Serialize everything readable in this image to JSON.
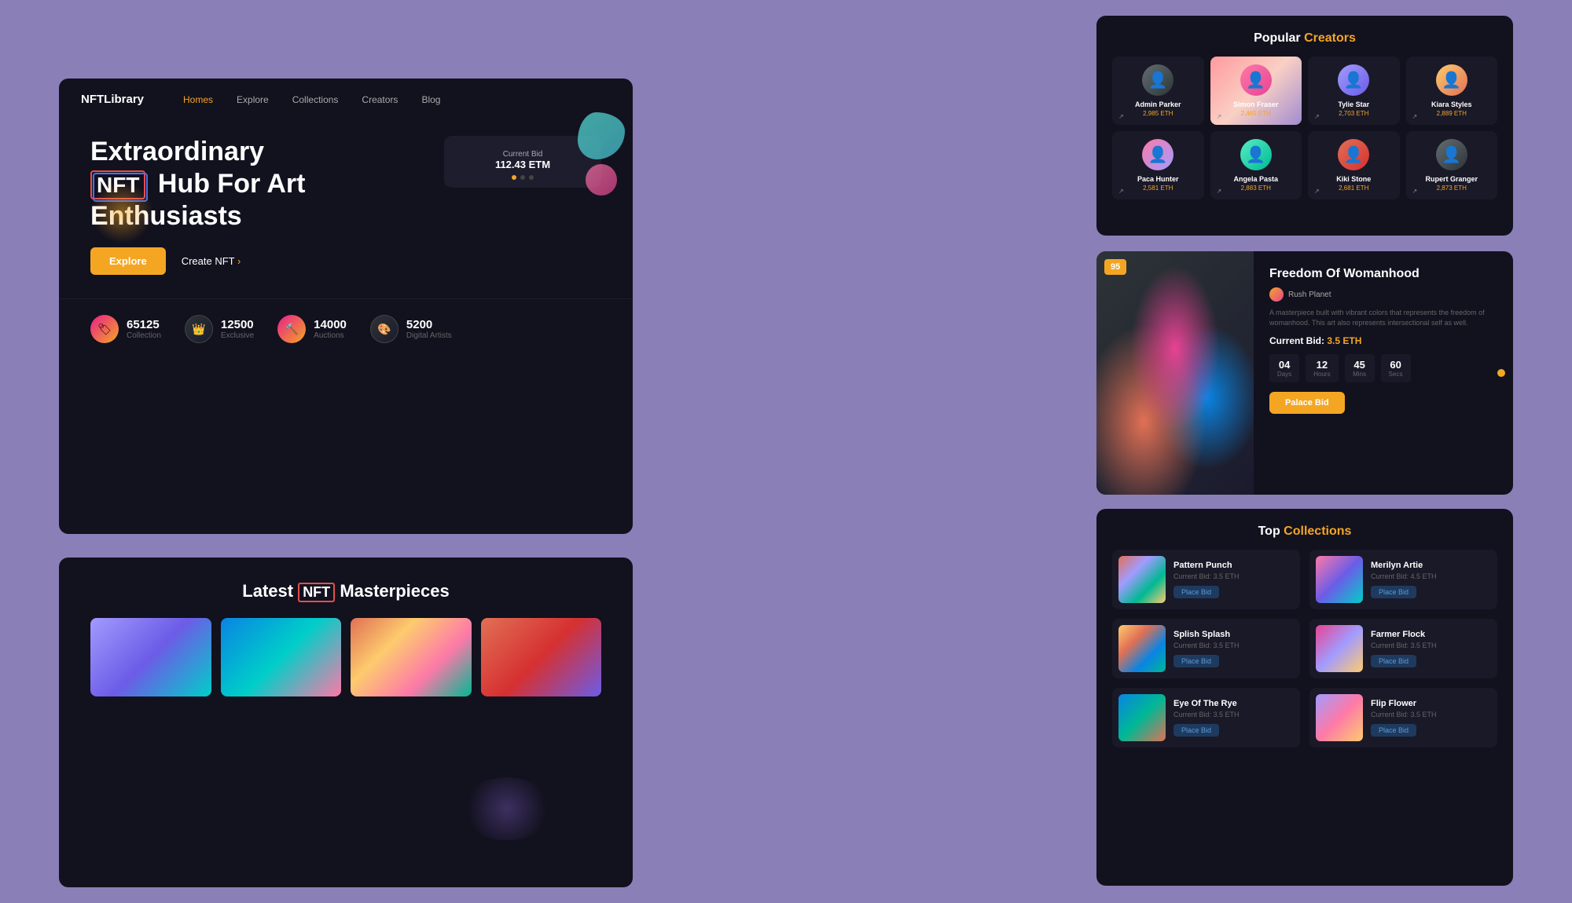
{
  "brand": "NFTLibrary",
  "nav": {
    "links": [
      "Homes",
      "Explore",
      "Collections",
      "Creators",
      "Blog"
    ],
    "active": "Homes"
  },
  "hero": {
    "line1": "Extraordinary",
    "nft_badge": "NFT",
    "line2": "Hub For Art",
    "line3": "Enthusiasts",
    "btn_explore": "Explore",
    "btn_create": "Create NFT",
    "current_bid_label": "Current Bid",
    "current_bid_value": "112.43 ETM",
    "dots": [
      true,
      false,
      false
    ]
  },
  "stats": [
    {
      "value": "65125",
      "label": "Collection"
    },
    {
      "value": "12500",
      "label": "Exclusive"
    },
    {
      "value": "14000",
      "label": "Auctions"
    },
    {
      "value": "5200",
      "label": "Digital Artists"
    }
  ],
  "popular_creators": {
    "title_plain": "Popular",
    "title_highlight": "Creators",
    "creators": [
      {
        "name": "Admin Parker",
        "eth": "2,985 ETH"
      },
      {
        "name": "Simon Fraser",
        "eth": "2,465 ETH",
        "featured": true
      },
      {
        "name": "Tylie Star",
        "eth": "2,703 ETH"
      },
      {
        "name": "Kiara Styles",
        "eth": "2,889 ETH"
      },
      {
        "name": "Paca Hunter",
        "eth": "2,581 ETH"
      },
      {
        "name": "Angela Pasta",
        "eth": "2,883 ETH"
      },
      {
        "name": "Kiki Stone",
        "eth": "2,681 ETH"
      },
      {
        "name": "Rupert Granger",
        "eth": "2,873 ETH"
      }
    ]
  },
  "featured_art": {
    "score": "95",
    "title": "Freedom Of Womanhood",
    "creator": "Rush Planet",
    "description": "A masterpiece built with vibrant colors that represents the freedom of womanhood. This art also represents intersectional self as well.",
    "bid_label": "Current Bid:",
    "bid_value": "3.5 ETH",
    "timer": [
      {
        "val": "04",
        "label": "Days"
      },
      {
        "val": "12",
        "label": "Hours"
      },
      {
        "val": "45",
        "label": "Mins"
      },
      {
        "val": "60",
        "label": "Secs"
      }
    ],
    "btn_palace": "Palace Bid"
  },
  "latest_masterpieces": {
    "title_plain": "Latest",
    "nft_badge": "NFT",
    "title_end": "Masterpieces"
  },
  "top_collections": {
    "title_plain": "Top",
    "title_highlight": "Collections",
    "items": [
      {
        "name": "Pattern Punch",
        "bid": "Current Bid: 3.5 ETH",
        "btn": "Place Bid"
      },
      {
        "name": "Merilyn Artie",
        "bid": "Current Bid: 4.5 ETH",
        "btn": "Place Bid"
      },
      {
        "name": "Splish Splash",
        "bid": "Current Bid: 3.5 ETH",
        "btn": "Place Bid"
      },
      {
        "name": "Farmer Flock",
        "bid": "Current Bid: 3.5 ETH",
        "btn": "Place Bid"
      },
      {
        "name": "Eye Of The Rye",
        "bid": "Current Bid: 3.5 ETH",
        "btn": "Place Bid"
      },
      {
        "name": "Flip Flower",
        "bid": "Current Bid: 3.5 ETH",
        "btn": "Place Bid"
      }
    ]
  }
}
